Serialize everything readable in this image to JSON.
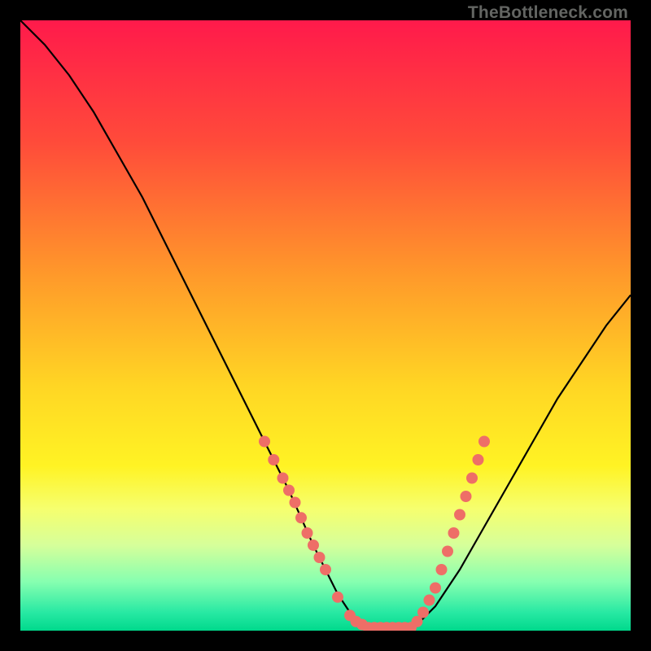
{
  "watermark": {
    "text": "TheBottleneck.com"
  },
  "gradient": {
    "stops": [
      {
        "offset": 0.0,
        "color": "#ff1a4b"
      },
      {
        "offset": 0.2,
        "color": "#ff4b3a"
      },
      {
        "offset": 0.42,
        "color": "#ff9a2a"
      },
      {
        "offset": 0.6,
        "color": "#ffd624"
      },
      {
        "offset": 0.73,
        "color": "#fff324"
      },
      {
        "offset": 0.8,
        "color": "#f6ff6e"
      },
      {
        "offset": 0.86,
        "color": "#d6ff9a"
      },
      {
        "offset": 0.92,
        "color": "#86ffb0"
      },
      {
        "offset": 0.97,
        "color": "#28e9a3"
      },
      {
        "offset": 1.0,
        "color": "#00d98c"
      }
    ]
  },
  "marker_style": {
    "color": "#ee6e67",
    "radius_px": 7
  },
  "chart_data": {
    "type": "line",
    "title": "",
    "xlabel": "",
    "ylabel": "",
    "xlim": [
      0,
      100
    ],
    "ylim": [
      0,
      100
    ],
    "series": [
      {
        "name": "bottleneck-curve",
        "x": [
          0,
          4,
          8,
          12,
          16,
          20,
          24,
          28,
          32,
          36,
          40,
          44,
          48,
          50,
          52,
          54,
          56,
          58,
          60,
          62,
          64,
          68,
          72,
          76,
          80,
          84,
          88,
          92,
          96,
          100
        ],
        "y": [
          100,
          96,
          91,
          85,
          78,
          71,
          63,
          55,
          47,
          39,
          31,
          23,
          14,
          10,
          6,
          3,
          1,
          0,
          0,
          0,
          0,
          4,
          10,
          17,
          24,
          31,
          38,
          44,
          50,
          55
        ]
      }
    ],
    "markers": [
      {
        "x": 40.0,
        "y": 31.0
      },
      {
        "x": 41.5,
        "y": 28.0
      },
      {
        "x": 43.0,
        "y": 25.0
      },
      {
        "x": 44.0,
        "y": 23.0
      },
      {
        "x": 45.0,
        "y": 21.0
      },
      {
        "x": 46.0,
        "y": 18.5
      },
      {
        "x": 47.0,
        "y": 16.0
      },
      {
        "x": 48.0,
        "y": 14.0
      },
      {
        "x": 49.0,
        "y": 12.0
      },
      {
        "x": 50.0,
        "y": 10.0
      },
      {
        "x": 52.0,
        "y": 5.5
      },
      {
        "x": 54.0,
        "y": 2.5
      },
      {
        "x": 55.0,
        "y": 1.5
      },
      {
        "x": 56.0,
        "y": 1.0
      },
      {
        "x": 57.0,
        "y": 0.5
      },
      {
        "x": 58.0,
        "y": 0.5
      },
      {
        "x": 59.0,
        "y": 0.5
      },
      {
        "x": 60.0,
        "y": 0.5
      },
      {
        "x": 61.0,
        "y": 0.5
      },
      {
        "x": 62.0,
        "y": 0.5
      },
      {
        "x": 63.0,
        "y": 0.5
      },
      {
        "x": 64.0,
        "y": 0.5
      },
      {
        "x": 65.0,
        "y": 1.5
      },
      {
        "x": 66.0,
        "y": 3.0
      },
      {
        "x": 67.0,
        "y": 5.0
      },
      {
        "x": 68.0,
        "y": 7.0
      },
      {
        "x": 69.0,
        "y": 10.0
      },
      {
        "x": 70.0,
        "y": 13.0
      },
      {
        "x": 71.0,
        "y": 16.0
      },
      {
        "x": 72.0,
        "y": 19.0
      },
      {
        "x": 73.0,
        "y": 22.0
      },
      {
        "x": 74.0,
        "y": 25.0
      },
      {
        "x": 75.0,
        "y": 28.0
      },
      {
        "x": 76.0,
        "y": 31.0
      }
    ]
  }
}
